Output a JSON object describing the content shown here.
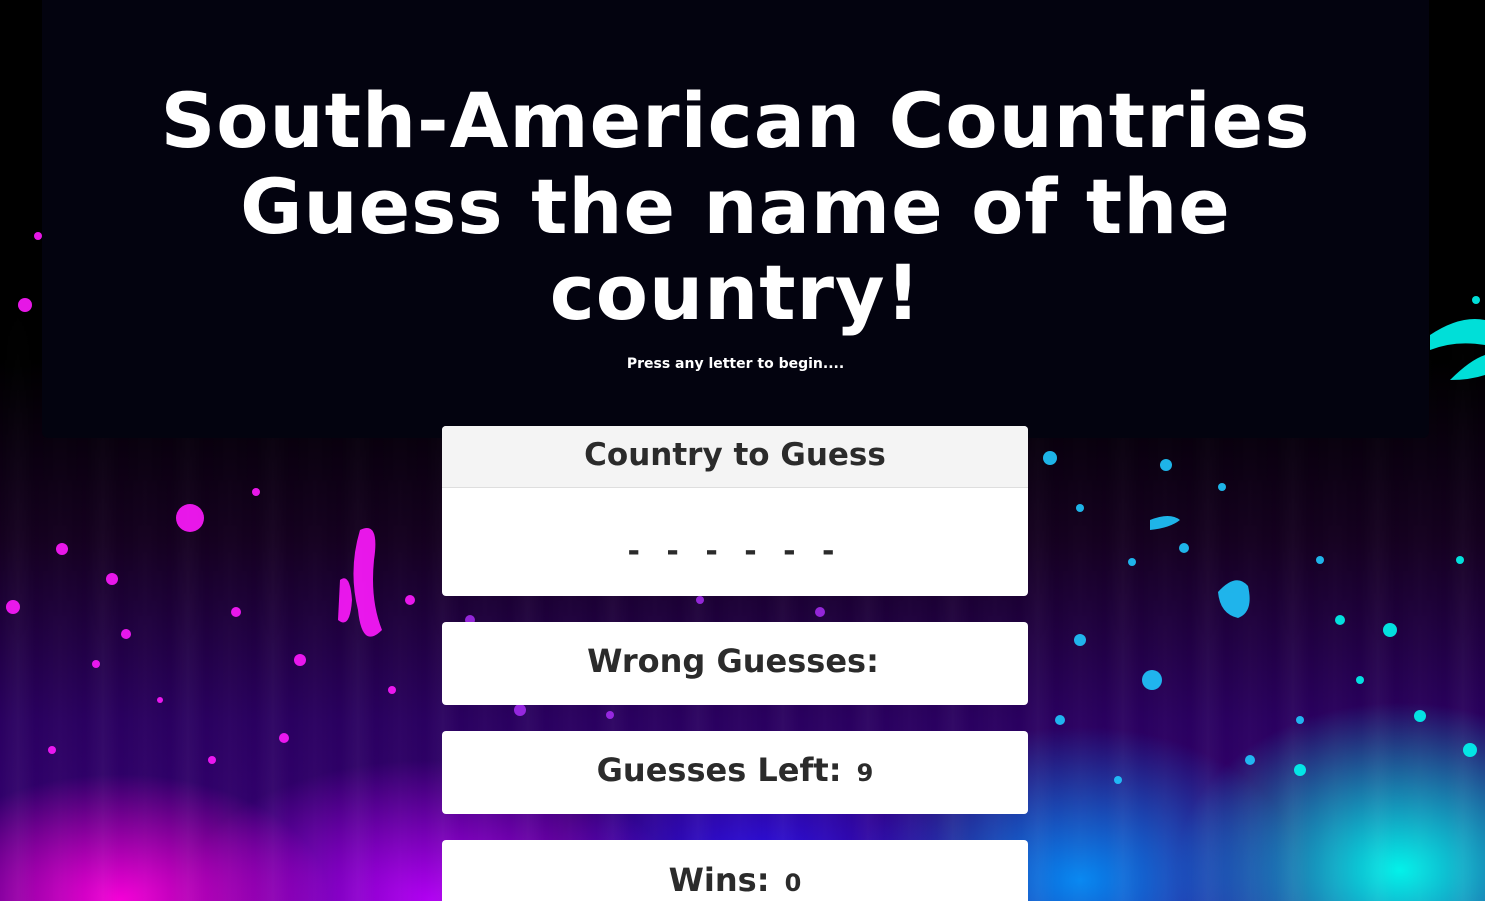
{
  "header": {
    "title_lines": [
      "South-American Countries",
      "Guess the name of the",
      "country!"
    ],
    "instructions": "Press any letter to begin...."
  },
  "game": {
    "word_card_title": "Country to Guess",
    "current_word": "- - - - - -",
    "wrong_guesses_label": "Wrong Guesses:",
    "wrong_guesses_value": "",
    "guesses_left_label": "Guesses Left:",
    "guesses_left_value": "9",
    "wins_label": "Wins:",
    "wins_value": "0"
  },
  "colors": {
    "header_bg": "#03030f",
    "card_bg": "#ffffff",
    "card_header_bg": "#f4f4f4",
    "text_dark": "#2b2b2b",
    "splatter_magenta": "#ff1aff",
    "splatter_cyan": "#00f0ff",
    "splatter_blue": "#2a8cff"
  }
}
